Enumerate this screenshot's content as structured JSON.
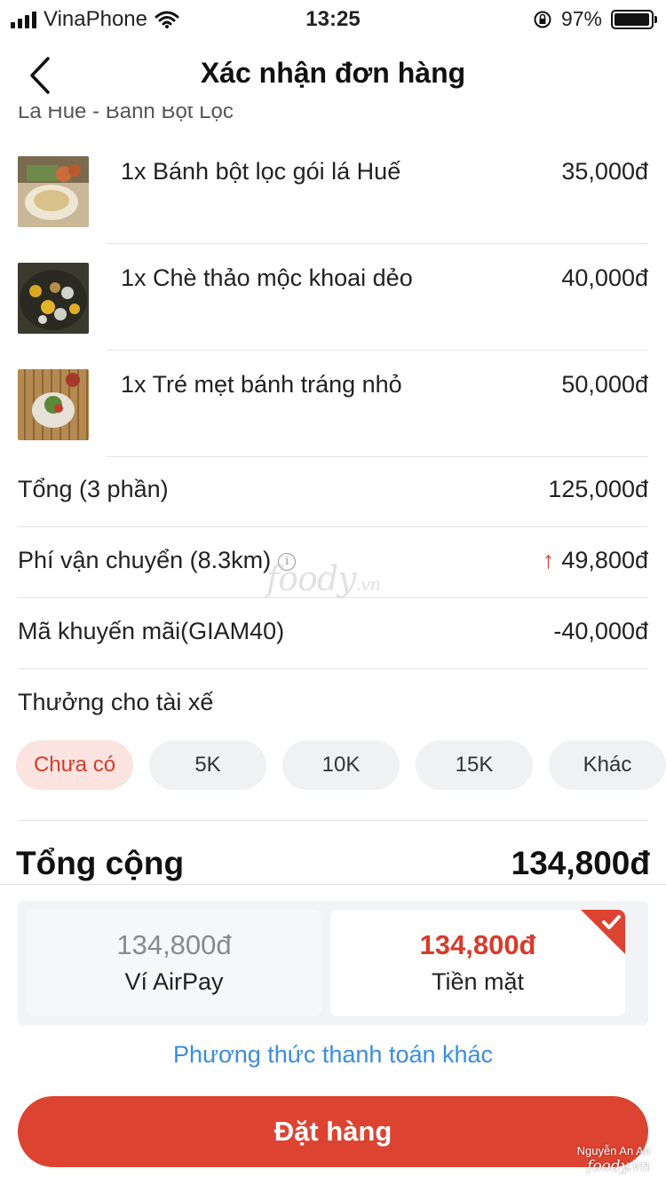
{
  "status_bar": {
    "carrier": "VinaPhone",
    "time": "13:25",
    "battery": "97%",
    "battery_level": 0.97
  },
  "header": {
    "title": "Xác nhận đơn hàng",
    "back_icon": "chevron-left-icon"
  },
  "shop": {
    "name": "Lá Huế - Bánh Bột Lọc"
  },
  "items": [
    {
      "name": "1x Bánh bột lọc gói lá Huế",
      "price": "35,000đ"
    },
    {
      "name": "1x Chè thảo mộc khoai dẻo",
      "price": "40,000đ"
    },
    {
      "name": "1x Tré mẹt bánh tráng nhỏ",
      "price": "50,000đ"
    }
  ],
  "summary": {
    "subtotal": {
      "label": "Tổng (3 phần)",
      "value": "125,000đ"
    },
    "shipping": {
      "label": "Phí vận chuyển (8.3km)",
      "value": "49,800đ",
      "info_icon": "info-icon",
      "trend_icon": "arrow-up-icon"
    },
    "promo": {
      "label": "Mã khuyến mãi(GIAM40)",
      "value": "-40,000đ"
    }
  },
  "tip": {
    "label": "Thưởng cho tài xế",
    "options": [
      "Chưa có",
      "5K",
      "10K",
      "15K",
      "Khác"
    ],
    "selected": "Chưa có"
  },
  "total": {
    "label": "Tổng cộng",
    "value": "134,800đ"
  },
  "payment": {
    "airpay": {
      "amount": "134,800đ",
      "name": "Ví AirPay"
    },
    "cash": {
      "amount": "134,800đ",
      "name": "Tiền mặt",
      "selected": true
    },
    "other_link": "Phương thức thanh toán khác"
  },
  "order_button": "Đặt hàng",
  "watermark": {
    "brand": "foody",
    "brand_suffix": ".vn",
    "user": "Nguyễn An An"
  },
  "colors": {
    "accent_red": "#dd4331",
    "link_blue": "#3a8ddf",
    "chip_selected_bg": "#fbe3e0"
  }
}
